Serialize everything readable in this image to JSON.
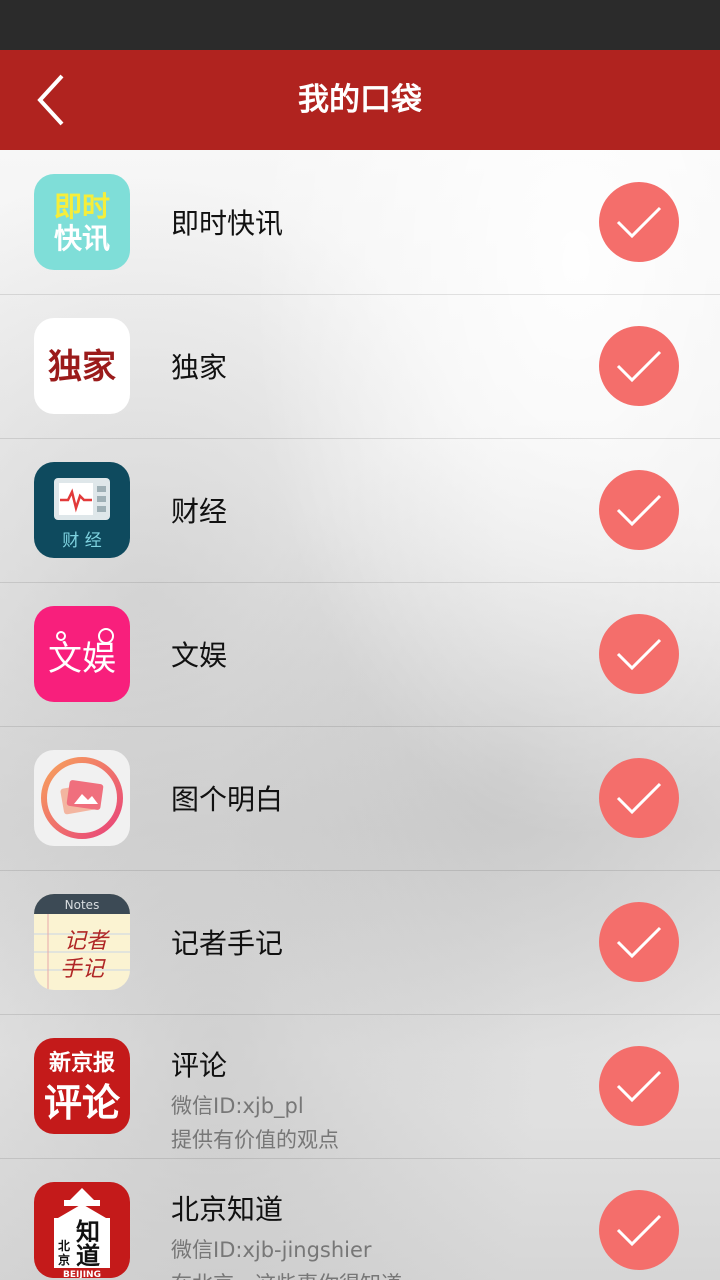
{
  "header": {
    "title": "我的口袋"
  },
  "items": [
    {
      "label": "即时快讯",
      "sub1": "",
      "sub2": "",
      "icon": "jishi-kuaixun-icon",
      "icon_text": "即时快讯",
      "color": "#7fded8"
    },
    {
      "label": "独家",
      "sub1": "",
      "sub2": "",
      "icon": "dujia-icon",
      "icon_text": "独家",
      "color": "#ffffff"
    },
    {
      "label": "财经",
      "sub1": "",
      "sub2": "",
      "icon": "caijing-icon",
      "icon_text": "财经",
      "color": "#0e4a5e"
    },
    {
      "label": "文娱",
      "sub1": "",
      "sub2": "",
      "icon": "wenyu-icon",
      "icon_text": "文娱",
      "color": "#f81f7c"
    },
    {
      "label": "图个明白",
      "sub1": "",
      "sub2": "",
      "icon": "photo-icon",
      "icon_text": "",
      "color": "#f1f1f1"
    },
    {
      "label": "记者手记",
      "sub1": "",
      "sub2": "",
      "icon": "notes-icon",
      "icon_text": "记者手记",
      "icon_header": "Notes",
      "color": "#fbf3d2"
    },
    {
      "label": "评论",
      "sub1": "微信ID:xjb_pl",
      "sub2": "提供有价值的观点",
      "icon": "pinglun-icon",
      "icon_text_top": "新京报",
      "icon_text": "评论",
      "color": "#c41a1a"
    },
    {
      "label": "北京知道",
      "sub1": "微信ID:xjb-jingshier",
      "sub2": "在北京，这些事你得知道",
      "icon": "beijing-zhidao-icon",
      "icon_text": "知道",
      "icon_text_small": "北京",
      "icon_footer": "BEIJING",
      "color": "#c41a1a"
    }
  ],
  "colors": {
    "topbar": "#b0231f",
    "check": "#f46e6b"
  }
}
